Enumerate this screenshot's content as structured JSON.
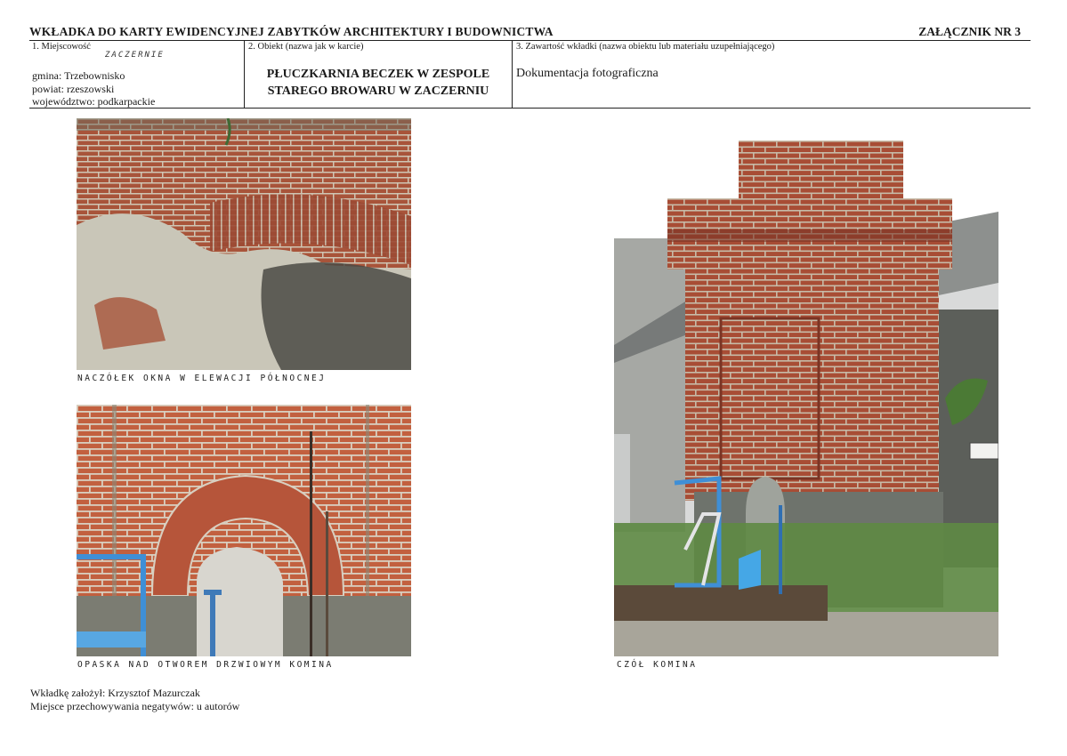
{
  "header": {
    "title": "WKŁADKA DO KARTY EWIDENCYJNEJ ZABYTKÓW ARCHITEKTURY I BUDOWNICTWA",
    "annex": "ZAŁĄCZNIK NR  3"
  },
  "location": {
    "label": "1. Miejscowość",
    "handwritten_place": "ZACZERNIE",
    "gmina": "gmina: Trzebownisko",
    "powiat": "powiat: rzeszowski",
    "wojewodztwo": "województwo: podkarpackie"
  },
  "object": {
    "label": "2. Obiekt (nazwa jak w karcie)",
    "name_line1": "PŁUCZKARNIA BECZEK  W ZESPOLE",
    "name_line2": "STAREGO BROWARU W ZACZERNIU"
  },
  "contents": {
    "label": "3. Zawartość wkładki (nazwa obiektu lub materiału uzupełniającego)",
    "value": "Dokumentacja fotograficzna"
  },
  "photos": [
    {
      "caption": "NACZÓŁEK OKNA W ELEWACJI PÓŁNOCNEJ",
      "icon": "brick-wall-window-arch"
    },
    {
      "caption": "OPASKA NAD OTWOREM DRZWIOWYM KOMINA",
      "icon": "brick-arch-doorway"
    },
    {
      "caption": "CZÓŁ KOMINA",
      "icon": "brick-chimney"
    }
  ],
  "footer": {
    "author": "Wkładkę założył: Krzysztof Mazurczak",
    "negatives": "Miejsce przechowywania negatywów: u autorów"
  },
  "colors": {
    "brick": "#a8543a",
    "plaster": "#c9c6b8",
    "rule": "#222222"
  }
}
